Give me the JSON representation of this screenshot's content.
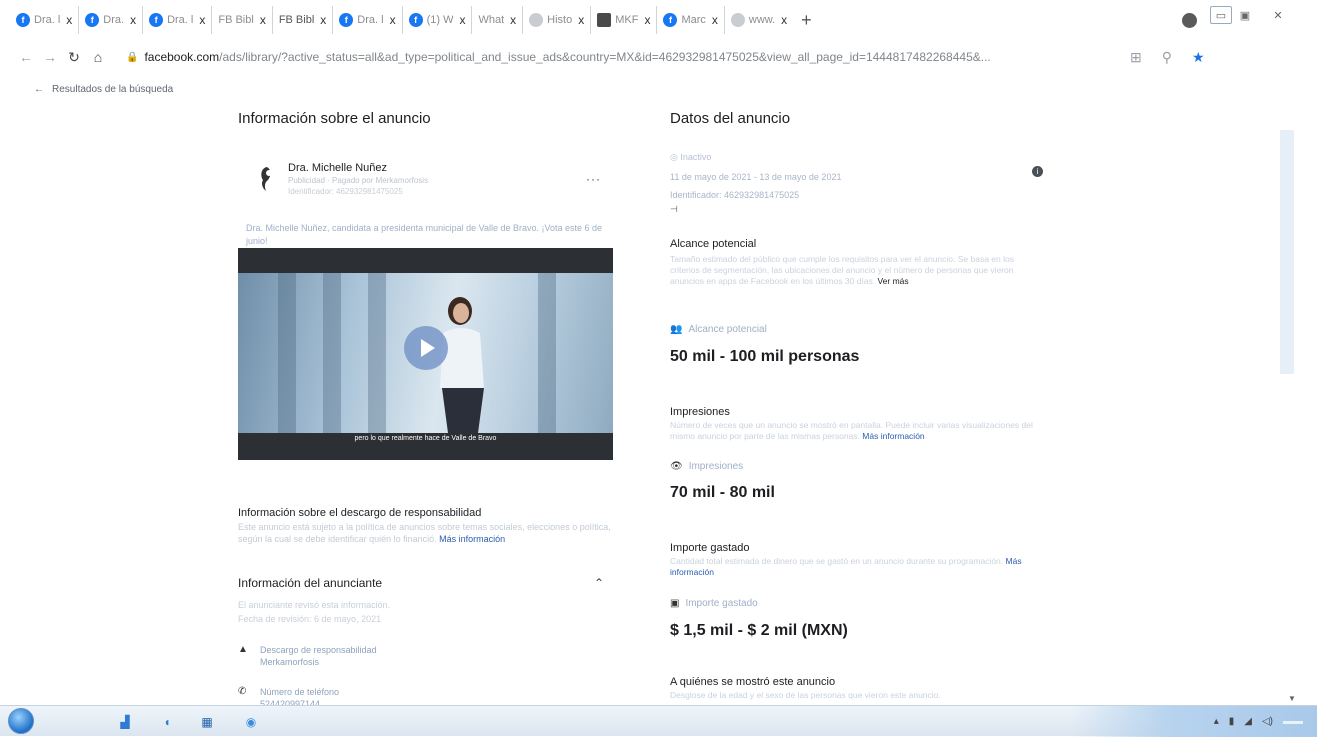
{
  "browser": {
    "tabs": [
      {
        "label": "Dra. l",
        "icon": "facebook-icon"
      },
      {
        "label": "Dra.",
        "icon": "facebook-icon"
      },
      {
        "label": "Dra. l",
        "icon": "facebook-icon"
      },
      {
        "label": "FB Bibl",
        "icon": ""
      },
      {
        "label": "FB Bibl",
        "icon": ""
      },
      {
        "label": "Dra. l",
        "icon": "facebook-icon"
      },
      {
        "label": "(1) W",
        "icon": "facebook-icon"
      },
      {
        "label": "What",
        "icon": ""
      },
      {
        "label": "Histo",
        "icon": "history-icon"
      },
      {
        "label": "MKF",
        "icon": "app-icon"
      },
      {
        "label": "Marc",
        "icon": "facebook-icon"
      },
      {
        "label": "www.",
        "icon": "globe-icon"
      }
    ],
    "close_glyph": "x",
    "new_tab": "+",
    "url_domain": "facebook.com",
    "url_rest": "/ads/library/?active_status=all&ad_type=political_and_issue_ads&country=MX&id=462932981475025&view_all_page_id=1444817482268445&..."
  },
  "back_link": {
    "arrow": "←",
    "label": "Resultados de la búsqueda"
  },
  "left": {
    "title": "Información sobre el anuncio",
    "advertiser_name": "Dra. Michelle Nuñez",
    "advertiser_sub": "Publicidad · Pagado por Merkamorfosis",
    "advertiser_id": "Identificador: 462932981475025",
    "more": "···",
    "ad_text": "Dra. Michelle Nuñez, candidata a presidenta municipal de Valle de Bravo. ¡Vota este 6 de junio!",
    "video_caption": "pero lo que realmente hace de Valle de Bravo",
    "disclaimer_title": "Información sobre el descargo de responsabilidad",
    "disclaimer_text": "Este anuncio está sujeto a la política de anuncios sobre temas sociales, elecciones o política, según la cual se debe identificar quién lo financió.",
    "disclaimer_link": "Más información",
    "advertiser_info_title": "Información del anunciante",
    "advertiser_info_line1": "El anunciante revisó esta información.",
    "advertiser_info_line2": "Fecha de revisión: 6 de mayo, 2021",
    "disclaimer_item_label": "Descargo de responsabilidad",
    "disclaimer_item_value": "Merkamorfosis",
    "phone_label": "Número de teléfono",
    "phone_value": "524420997144"
  },
  "right": {
    "title": "Datos del anuncio",
    "status": "Inactivo",
    "dates": "11 de mayo de 2021 - 13 de mayo de 2021",
    "identifier": "Identificador: 462932981475025",
    "dash": "⊣",
    "reach_title": "Alcance potencial",
    "reach_desc": "Tamaño estimado del público que cumple los requisitos para ver el anuncio. Se basa en los criterios de segmentación, las ubicaciones del anuncio y el número de personas que vieron anuncios en apps de Facebook en los últimos 30 días.",
    "reach_link": "Ver más",
    "reach_label": "Alcance potencial",
    "reach_value": "50 mil - 100 mil personas",
    "impr_title": "Impresiones",
    "impr_desc": "Número de veces que un anuncio se mostró en pantalla. Puede incluir varias visualizaciones del mismo anuncio por parte de las mismas personas.",
    "impr_link": "Más información",
    "impr_label": "Impresiones",
    "impr_value": "70 mil - 80 mil",
    "spend_title": "Importe gastado",
    "spend_desc": "Cantidad total estimada de dinero que se gastó en un anuncio durante su programación.",
    "spend_link": "Más información",
    "spend_label": "Importe gastado",
    "spend_value": "$ 1,5 mil - $ 2 mil (MXN)",
    "shown_title": "A quiénes se mostró este anuncio",
    "shown_desc": "Desglose de la edad y el sexo de las personas que vieron este anuncio."
  },
  "colors": {
    "facebook_blue": "#1877f2",
    "link": "#2a5db0",
    "chrome_star": "#1a73e8"
  }
}
